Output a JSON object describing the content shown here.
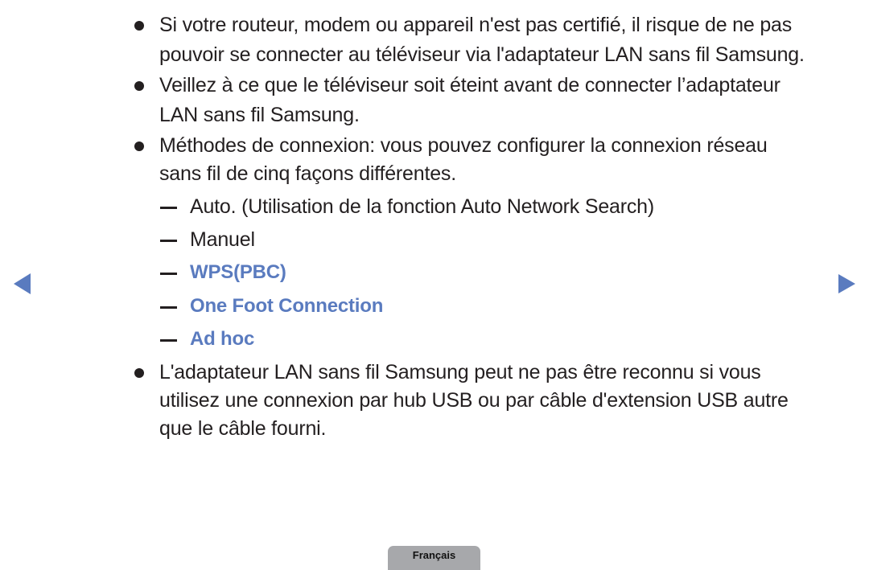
{
  "colors": {
    "text": "#231f20",
    "link": "#5a7bbf",
    "tab": "#a7a8ab"
  },
  "bullets": [
    {
      "lines": [
        "Si votre routeur, modem ou appareil n'est pas certifié, il risque de ne pas",
        "pouvoir se connecter au téléviseur via l'adaptateur LAN sans fil Samsung."
      ]
    },
    {
      "lines": [
        "Veillez à ce que le téléviseur soit éteint avant de connecter l’adaptateur",
        "LAN sans fil Samsung."
      ]
    },
    {
      "lines": [
        "Méthodes de connexion: vous pouvez configurer la connexion réseau",
        "sans fil de cinq façons différentes."
      ]
    },
    {
      "lines": [
        "L'adaptateur LAN sans fil Samsung peut ne pas être reconnu si vous",
        "utilisez une connexion par hub USB ou par câble d'extension USB autre",
        "que le câble fourni."
      ]
    }
  ],
  "methods": [
    {
      "label": "Auto. (Utilisation de la fonction Auto Network Search)",
      "link": false
    },
    {
      "label": "Manuel",
      "link": false
    },
    {
      "label": "WPS(PBC)",
      "link": true
    },
    {
      "label": "One Foot Connection",
      "link": true
    },
    {
      "label": "Ad hoc",
      "link": true
    }
  ],
  "navigation": {
    "prev_icon": "triangle-left",
    "next_icon": "triangle-right"
  },
  "footer": {
    "language_tab": "Français"
  }
}
